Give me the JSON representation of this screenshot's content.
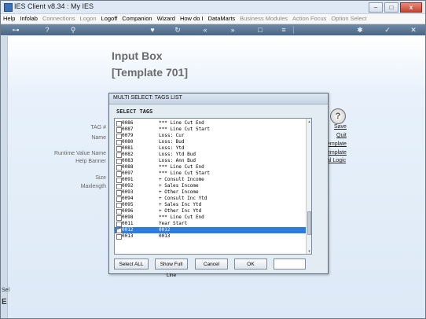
{
  "window": {
    "title": "IES Client v8.34 : My IES"
  },
  "window_controls": {
    "minimize": "–",
    "maximize": "□",
    "close": "x"
  },
  "menu": [
    {
      "label": "Help",
      "enabled": true
    },
    {
      "label": "Infolab",
      "enabled": true
    },
    {
      "label": "Connections",
      "enabled": false
    },
    {
      "label": "Logon",
      "enabled": false
    },
    {
      "label": "Logoff",
      "enabled": true
    },
    {
      "label": "Companion",
      "enabled": true
    },
    {
      "label": "Wizard",
      "enabled": true
    },
    {
      "label": "How do I",
      "enabled": true
    },
    {
      "label": "DataMarts",
      "enabled": true
    },
    {
      "label": "Business Modules",
      "enabled": false
    },
    {
      "label": "Action Focus",
      "enabled": false
    },
    {
      "label": "Option Select",
      "enabled": false
    }
  ],
  "toolbar_icons": [
    "key-icon",
    "help-icon",
    "search-icon",
    "heart-icon",
    "refresh-icon",
    "back-icon",
    "forward-icon",
    "stop-icon",
    "list-icon",
    "settings-icon",
    "check-icon",
    "close-icon"
  ],
  "main": {
    "heading": "Input Box",
    "subheading": "[Template 701]",
    "fields": {
      "tag": "TAG #",
      "name": "Name",
      "runtime_value_name": "Runtime Value Name",
      "help_banner": "Help Banner",
      "size": "Size",
      "maxlength": "Maxlength"
    },
    "links": {
      "save": "Save",
      "quit": "Quit",
      "template1": "emplate",
      "template2": "emplate",
      "logic": "al Logic"
    },
    "help_icon_glyph": "?"
  },
  "left_edge": {
    "text1": "Sel",
    "text2": "E"
  },
  "dialog": {
    "title": "MULTI SELECT: TAGS LIST",
    "header": "SELECT TAGS",
    "rows": [
      {
        "code": "0086",
        "desc": "*** Line Cut End",
        "checked": false,
        "selected": false
      },
      {
        "code": "0087",
        "desc": "*** Line Cut Start",
        "checked": false,
        "selected": false
      },
      {
        "code": "0079",
        "desc": "Loss: Cur",
        "checked": false,
        "selected": false
      },
      {
        "code": "0080",
        "desc": "Loss: Bud",
        "checked": false,
        "selected": false
      },
      {
        "code": "0081",
        "desc": "Loss: Ytd",
        "checked": false,
        "selected": false
      },
      {
        "code": "0082",
        "desc": "Loss: Ytd Bud",
        "checked": false,
        "selected": false
      },
      {
        "code": "0083",
        "desc": "Loss: Ann Bud",
        "checked": false,
        "selected": false
      },
      {
        "code": "0088",
        "desc": "*** Line Cut End",
        "checked": false,
        "selected": false
      },
      {
        "code": "0097",
        "desc": "*** Line Cut Start",
        "checked": false,
        "selected": false
      },
      {
        "code": "0091",
        "desc": "+ Consult Income",
        "checked": false,
        "selected": false
      },
      {
        "code": "0092",
        "desc": "+ Sales Income",
        "checked": false,
        "selected": false
      },
      {
        "code": "0093",
        "desc": "+ Other Income",
        "checked": false,
        "selected": false
      },
      {
        "code": "0094",
        "desc": "+ Consult Inc Ytd",
        "checked": false,
        "selected": false
      },
      {
        "code": "0095",
        "desc": "+ Sales Inc Ytd",
        "checked": false,
        "selected": false
      },
      {
        "code": "0096",
        "desc": "+ Other Inc Ytd",
        "checked": false,
        "selected": false
      },
      {
        "code": "0098",
        "desc": "*** Line Cut End",
        "checked": false,
        "selected": false
      },
      {
        "code": "0011",
        "desc": "Year Start",
        "checked": false,
        "selected": false
      },
      {
        "code": "0012",
        "desc": "0012",
        "checked": true,
        "selected": true
      },
      {
        "code": "0013",
        "desc": "0013",
        "checked": false,
        "selected": false
      }
    ],
    "buttons": {
      "select_all": "Select ALL",
      "show_full_line": "Show Full Line",
      "cancel": "Cancel",
      "ok": "OK"
    },
    "input_value": ""
  }
}
